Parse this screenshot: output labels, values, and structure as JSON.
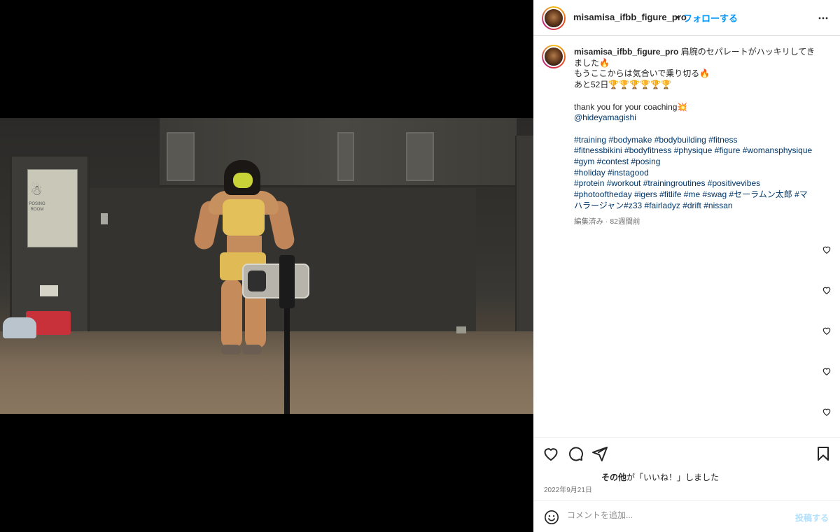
{
  "header": {
    "username": "misamisa_ifbb_figure_pro",
    "separator": "•",
    "follow_label": "フォローする"
  },
  "caption": {
    "username": "misamisa_ifbb_figure_pro",
    "lines": [
      "肩腕のセパレートがハッキリしてき",
      "ました🔥",
      "もうここからは気合いで乗り切る🔥",
      "あと52日🏆🏆🏆🏆🏆🏆",
      "",
      "thank you for your coaching💥",
      "@hideyamagishi",
      "",
      "#training #bodymake #bodybuilding #fitness",
      "#fitnessbikini #bodyfitness #physique #figure #womansphysique",
      "#gym #contest #posing",
      "#holiday #instagood",
      "#protein #workout #trainingroutines #positivevibes",
      "#photooftheday #igers #fitlife #me #swag #セーラムン太郎 #マ",
      "ハラージャン#z33 #fairladyz #drift #nissan"
    ],
    "meta": "編集済み · 82週間前"
  },
  "photo": {
    "door_sign_text": "POSING\nROOM"
  },
  "actions": {
    "likes_prefix": "その他",
    "likes_suffix": "が「いいね！」しました",
    "date": "2022年9月21日"
  },
  "comment": {
    "placeholder": "コメントを追加...",
    "post_label": "投稿する"
  },
  "colors": {
    "follow": "#0095f6",
    "hashtag": "#00376b",
    "post_disabled": "#b2dffc"
  }
}
